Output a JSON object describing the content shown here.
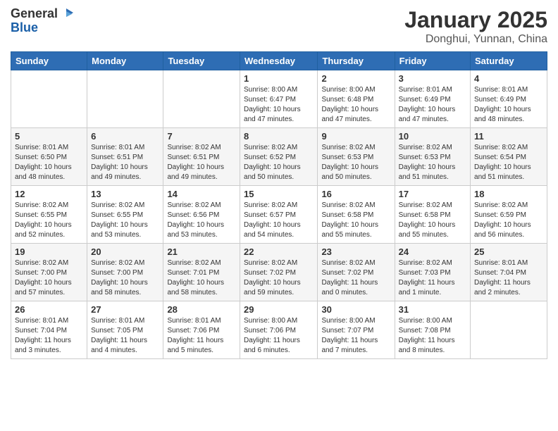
{
  "header": {
    "logo_line1": "General",
    "logo_line2": "Blue",
    "month_title": "January 2025",
    "location": "Donghui, Yunnan, China"
  },
  "weekdays": [
    "Sunday",
    "Monday",
    "Tuesday",
    "Wednesday",
    "Thursday",
    "Friday",
    "Saturday"
  ],
  "weeks": [
    [
      {
        "day": "",
        "info": ""
      },
      {
        "day": "",
        "info": ""
      },
      {
        "day": "",
        "info": ""
      },
      {
        "day": "1",
        "info": "Sunrise: 8:00 AM\nSunset: 6:47 PM\nDaylight: 10 hours\nand 47 minutes."
      },
      {
        "day": "2",
        "info": "Sunrise: 8:00 AM\nSunset: 6:48 PM\nDaylight: 10 hours\nand 47 minutes."
      },
      {
        "day": "3",
        "info": "Sunrise: 8:01 AM\nSunset: 6:49 PM\nDaylight: 10 hours\nand 47 minutes."
      },
      {
        "day": "4",
        "info": "Sunrise: 8:01 AM\nSunset: 6:49 PM\nDaylight: 10 hours\nand 48 minutes."
      }
    ],
    [
      {
        "day": "5",
        "info": "Sunrise: 8:01 AM\nSunset: 6:50 PM\nDaylight: 10 hours\nand 48 minutes."
      },
      {
        "day": "6",
        "info": "Sunrise: 8:01 AM\nSunset: 6:51 PM\nDaylight: 10 hours\nand 49 minutes."
      },
      {
        "day": "7",
        "info": "Sunrise: 8:02 AM\nSunset: 6:51 PM\nDaylight: 10 hours\nand 49 minutes."
      },
      {
        "day": "8",
        "info": "Sunrise: 8:02 AM\nSunset: 6:52 PM\nDaylight: 10 hours\nand 50 minutes."
      },
      {
        "day": "9",
        "info": "Sunrise: 8:02 AM\nSunset: 6:53 PM\nDaylight: 10 hours\nand 50 minutes."
      },
      {
        "day": "10",
        "info": "Sunrise: 8:02 AM\nSunset: 6:53 PM\nDaylight: 10 hours\nand 51 minutes."
      },
      {
        "day": "11",
        "info": "Sunrise: 8:02 AM\nSunset: 6:54 PM\nDaylight: 10 hours\nand 51 minutes."
      }
    ],
    [
      {
        "day": "12",
        "info": "Sunrise: 8:02 AM\nSunset: 6:55 PM\nDaylight: 10 hours\nand 52 minutes."
      },
      {
        "day": "13",
        "info": "Sunrise: 8:02 AM\nSunset: 6:55 PM\nDaylight: 10 hours\nand 53 minutes."
      },
      {
        "day": "14",
        "info": "Sunrise: 8:02 AM\nSunset: 6:56 PM\nDaylight: 10 hours\nand 53 minutes."
      },
      {
        "day": "15",
        "info": "Sunrise: 8:02 AM\nSunset: 6:57 PM\nDaylight: 10 hours\nand 54 minutes."
      },
      {
        "day": "16",
        "info": "Sunrise: 8:02 AM\nSunset: 6:58 PM\nDaylight: 10 hours\nand 55 minutes."
      },
      {
        "day": "17",
        "info": "Sunrise: 8:02 AM\nSunset: 6:58 PM\nDaylight: 10 hours\nand 55 minutes."
      },
      {
        "day": "18",
        "info": "Sunrise: 8:02 AM\nSunset: 6:59 PM\nDaylight: 10 hours\nand 56 minutes."
      }
    ],
    [
      {
        "day": "19",
        "info": "Sunrise: 8:02 AM\nSunset: 7:00 PM\nDaylight: 10 hours\nand 57 minutes."
      },
      {
        "day": "20",
        "info": "Sunrise: 8:02 AM\nSunset: 7:00 PM\nDaylight: 10 hours\nand 58 minutes."
      },
      {
        "day": "21",
        "info": "Sunrise: 8:02 AM\nSunset: 7:01 PM\nDaylight: 10 hours\nand 58 minutes."
      },
      {
        "day": "22",
        "info": "Sunrise: 8:02 AM\nSunset: 7:02 PM\nDaylight: 10 hours\nand 59 minutes."
      },
      {
        "day": "23",
        "info": "Sunrise: 8:02 AM\nSunset: 7:02 PM\nDaylight: 11 hours\nand 0 minutes."
      },
      {
        "day": "24",
        "info": "Sunrise: 8:02 AM\nSunset: 7:03 PM\nDaylight: 11 hours\nand 1 minute."
      },
      {
        "day": "25",
        "info": "Sunrise: 8:01 AM\nSunset: 7:04 PM\nDaylight: 11 hours\nand 2 minutes."
      }
    ],
    [
      {
        "day": "26",
        "info": "Sunrise: 8:01 AM\nSunset: 7:04 PM\nDaylight: 11 hours\nand 3 minutes."
      },
      {
        "day": "27",
        "info": "Sunrise: 8:01 AM\nSunset: 7:05 PM\nDaylight: 11 hours\nand 4 minutes."
      },
      {
        "day": "28",
        "info": "Sunrise: 8:01 AM\nSunset: 7:06 PM\nDaylight: 11 hours\nand 5 minutes."
      },
      {
        "day": "29",
        "info": "Sunrise: 8:00 AM\nSunset: 7:06 PM\nDaylight: 11 hours\nand 6 minutes."
      },
      {
        "day": "30",
        "info": "Sunrise: 8:00 AM\nSunset: 7:07 PM\nDaylight: 11 hours\nand 7 minutes."
      },
      {
        "day": "31",
        "info": "Sunrise: 8:00 AM\nSunset: 7:08 PM\nDaylight: 11 hours\nand 8 minutes."
      },
      {
        "day": "",
        "info": ""
      }
    ]
  ]
}
